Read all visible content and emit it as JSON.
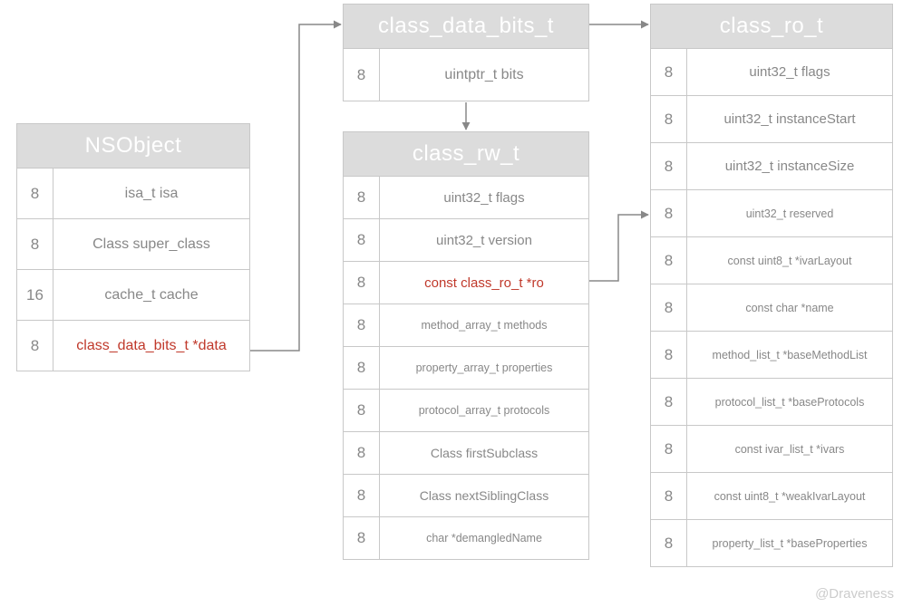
{
  "credit": "@Draveness",
  "nsobject": {
    "title": "NSObject",
    "rows": [
      {
        "size": "8",
        "field": "isa_t isa"
      },
      {
        "size": "8",
        "field": "Class super_class"
      },
      {
        "size": "16",
        "field": "cache_t cache"
      },
      {
        "size": "8",
        "field": "class_data_bits_t *data"
      }
    ]
  },
  "class_data_bits_t": {
    "title": "class_data_bits_t",
    "rows": [
      {
        "size": "8",
        "field": "uintptr_t bits"
      }
    ]
  },
  "class_rw_t": {
    "title": "class_rw_t",
    "rows": [
      {
        "size": "8",
        "field": "uint32_t flags"
      },
      {
        "size": "8",
        "field": "uint32_t version"
      },
      {
        "size": "8",
        "field": "const class_ro_t *ro"
      },
      {
        "size": "8",
        "field": "method_array_t methods"
      },
      {
        "size": "8",
        "field": "property_array_t properties"
      },
      {
        "size": "8",
        "field": "protocol_array_t protocols"
      },
      {
        "size": "8",
        "field": "Class firstSubclass"
      },
      {
        "size": "8",
        "field": "Class nextSiblingClass"
      },
      {
        "size": "8",
        "field": "char *demangledName"
      }
    ]
  },
  "class_ro_t": {
    "title": "class_ro_t",
    "rows": [
      {
        "size": "8",
        "field": "uint32_t flags"
      },
      {
        "size": "8",
        "field": "uint32_t instanceStart"
      },
      {
        "size": "8",
        "field": "uint32_t instanceSize"
      },
      {
        "size": "8",
        "field": "uint32_t reserved"
      },
      {
        "size": "8",
        "field": "const uint8_t *ivarLayout"
      },
      {
        "size": "8",
        "field": "const char *name"
      },
      {
        "size": "8",
        "field": "method_list_t *baseMethodList"
      },
      {
        "size": "8",
        "field": "protocol_list_t *baseProtocols"
      },
      {
        "size": "8",
        "field": "const ivar_list_t *ivars"
      },
      {
        "size": "8",
        "field": "const uint8_t *weakIvarLayout"
      },
      {
        "size": "8",
        "field": "property_list_t *baseProperties"
      }
    ]
  }
}
